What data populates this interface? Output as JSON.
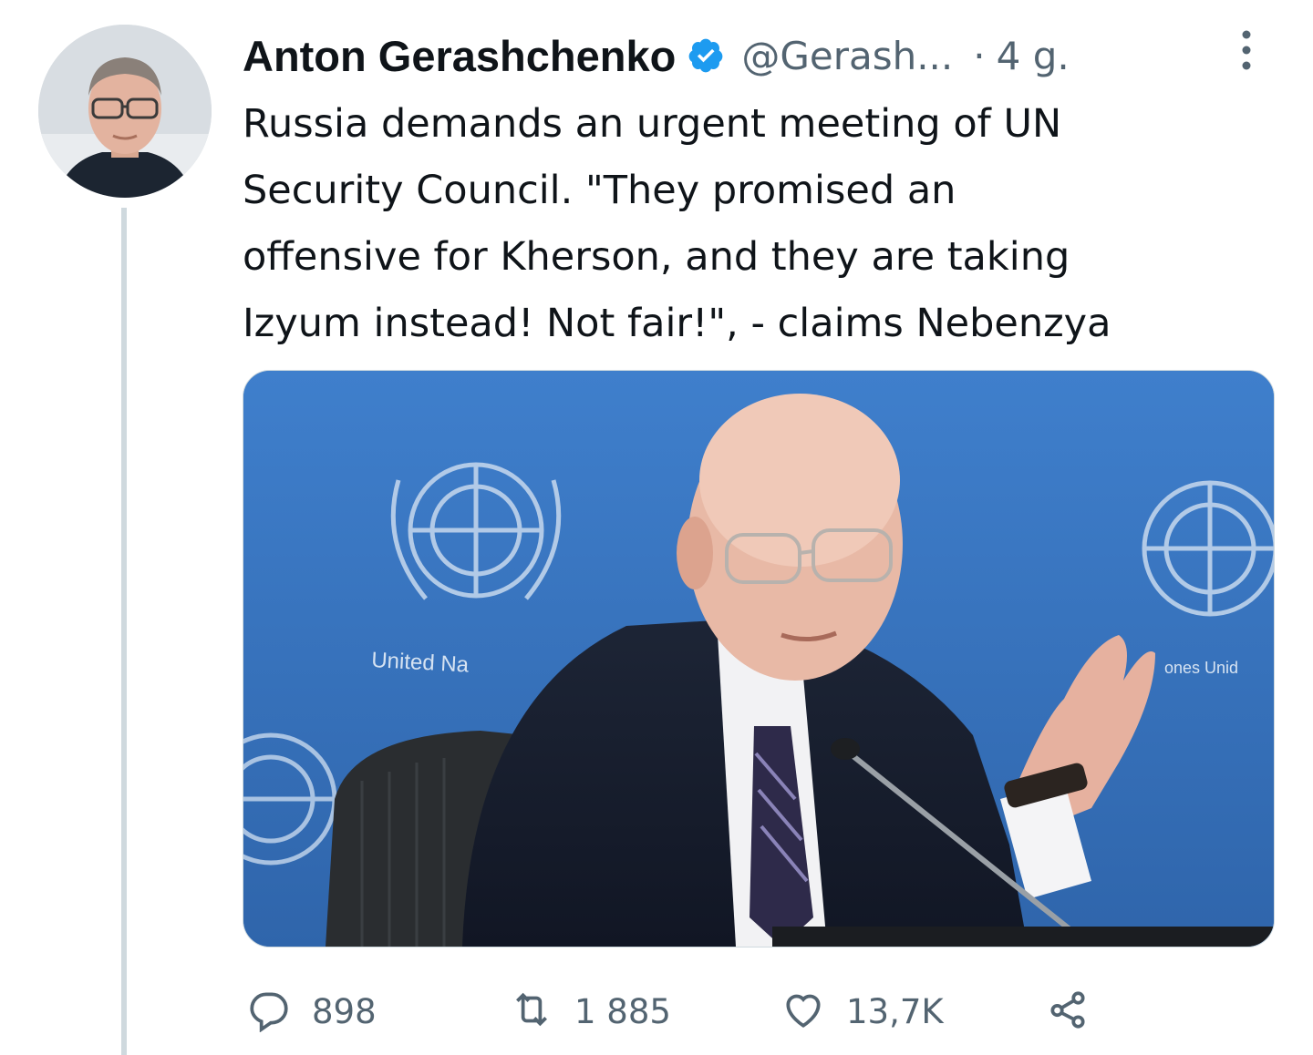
{
  "tweet": {
    "author_name": "Anton Gerashchenko",
    "handle": "@Gerash...",
    "separator": "·",
    "time": "4 g.",
    "text": "Russia demands an urgent meeting of UN\nSecurity Council. \"They promised an\noffensive for Kherson, and they are taking\nIzyum instead! Not fair!\", - claims Nebenzya"
  },
  "media": {
    "backdrop_text_left": "United Na",
    "backdrop_text_right": "ones Unid"
  },
  "actions": {
    "reply_count": "898",
    "retweet_count": "1 885",
    "like_count": "13,7K"
  },
  "icons": {
    "verified": "verified-badge-icon",
    "more": "more-options-icon",
    "reply": "reply-icon",
    "retweet": "retweet-icon",
    "like": "like-icon",
    "share": "share-icon"
  },
  "colors": {
    "text": "#0f1419",
    "secondary": "#536471",
    "verified": "#1d9bf0",
    "thread_line": "#cfd9de",
    "un_blue": "#3a78c2"
  }
}
